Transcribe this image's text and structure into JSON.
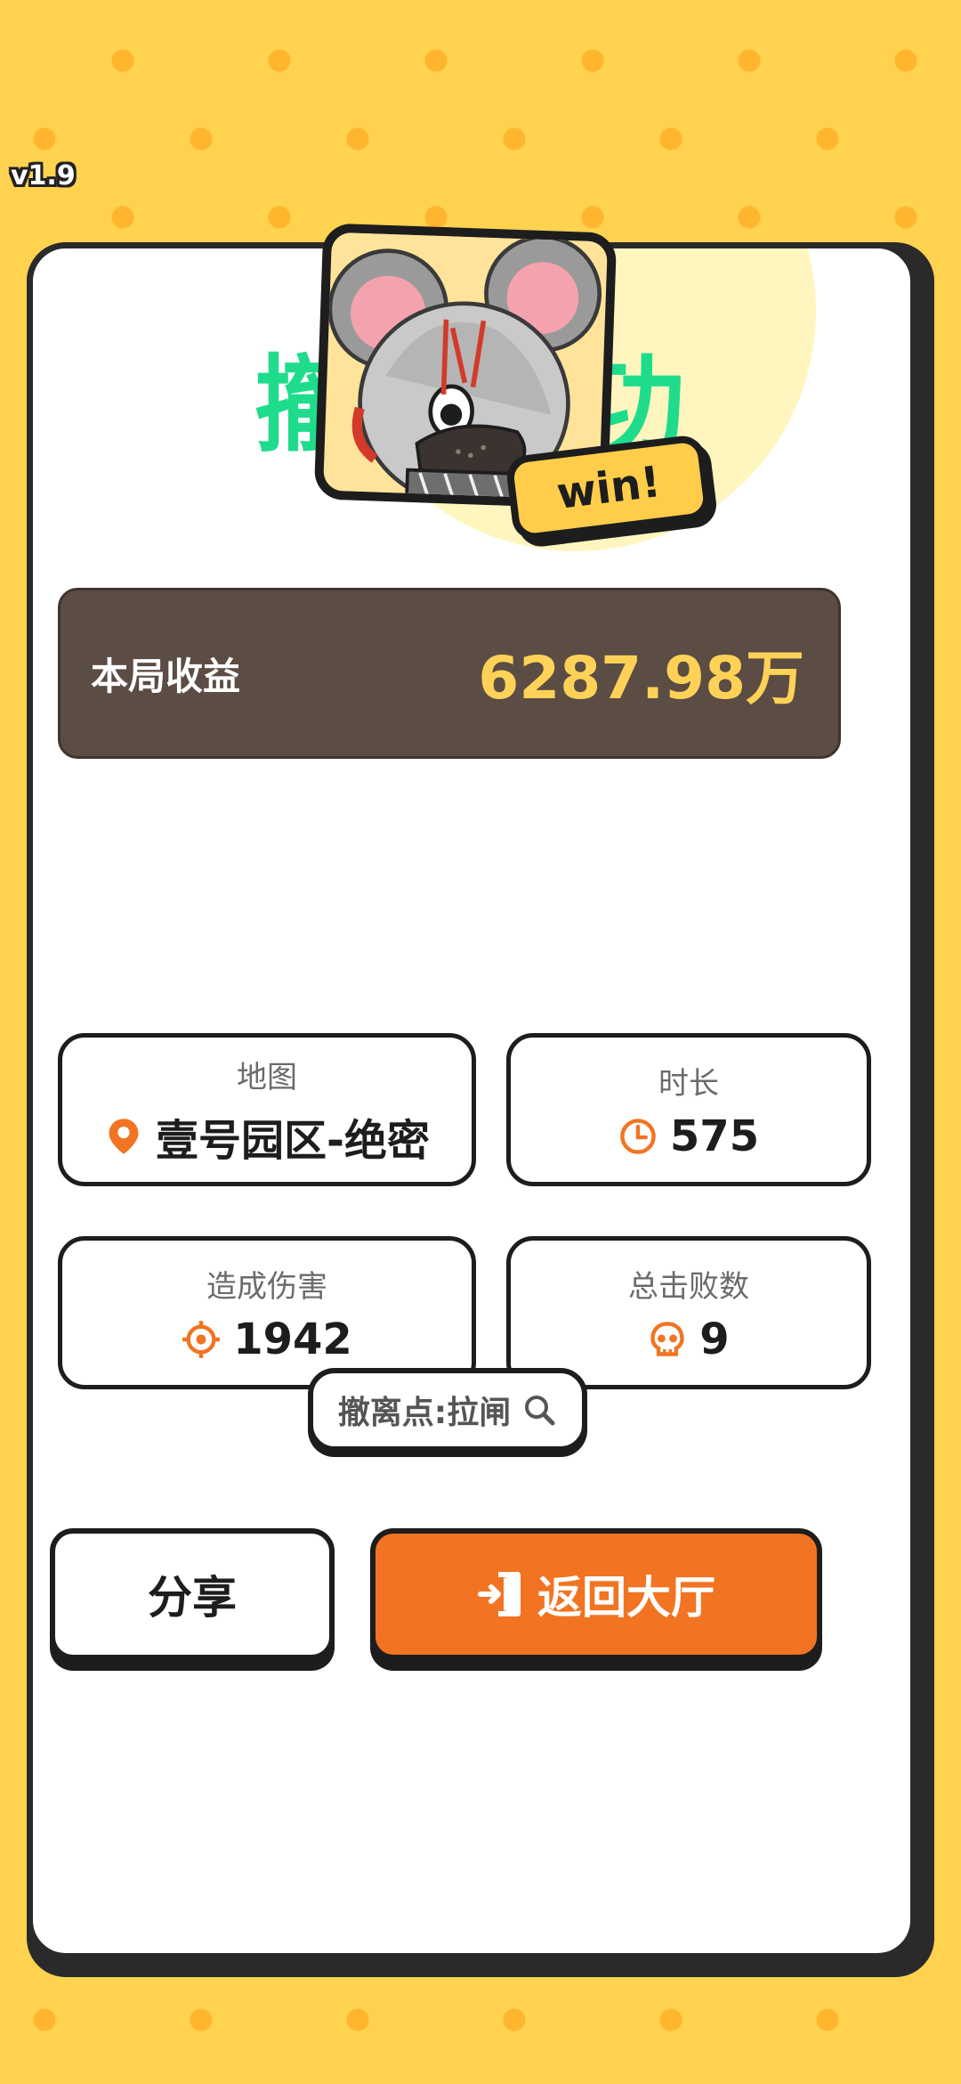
{
  "version": "v1.9",
  "result_title": "撤离成功",
  "badge": "win!",
  "earnings": {
    "label": "本局收益",
    "value": "6287.98万"
  },
  "stats": {
    "map": {
      "label": "地图",
      "value": "壹号园区-绝密",
      "icon": "location-pin-icon"
    },
    "duration": {
      "label": "时长",
      "value": "575",
      "icon": "clock-icon"
    },
    "damage": {
      "label": "造成伤害",
      "value": "1942",
      "icon": "crosshair-icon"
    },
    "kills": {
      "label": "总击败数",
      "value": "9",
      "icon": "skull-icon"
    }
  },
  "extraction": {
    "text": "撤离点:拉闸",
    "icon": "magnifier-icon"
  },
  "buttons": {
    "share": "分享",
    "return_lobby": "返回大厅"
  },
  "colors": {
    "background": "#ffd24f",
    "title_green": "#1fdc8c",
    "earnings_bg": "#5b4c44",
    "earnings_value": "#ffd257",
    "icon_orange": "#f27422",
    "lobby_button": "#f27422"
  }
}
